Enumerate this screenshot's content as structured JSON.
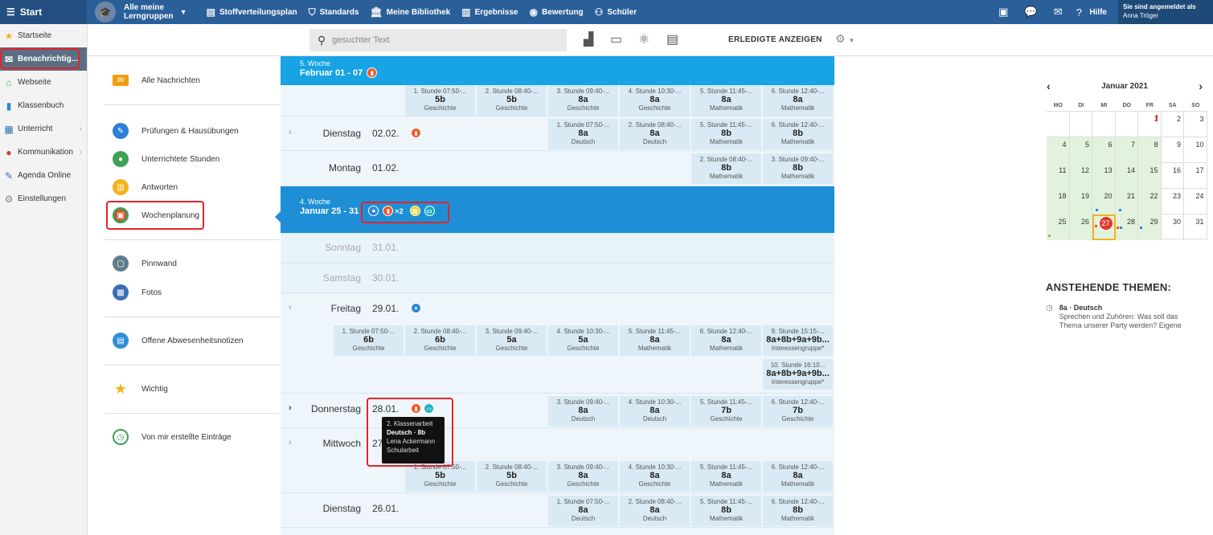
{
  "topbar": {
    "start": "Start",
    "group_line1": "Alle meine",
    "group_line2": "Lerngruppen",
    "items": [
      "Stoffverteilungsplan",
      "Standards",
      "Meine Bibliothek",
      "Ergebnisse",
      "Bewertung",
      "Schüler"
    ],
    "hilfe": "Hilfe",
    "user_label": "Sie sind angemeldet als",
    "user_name": "Anna Tröger"
  },
  "sidebar": {
    "items": [
      {
        "label": "Startseite",
        "icon": "star-icon",
        "color": "#f2b31c"
      },
      {
        "label": "Benachrichtig...",
        "icon": "mail-icon",
        "color": "#ffffff"
      },
      {
        "label": "Webseite",
        "icon": "home-icon",
        "color": "#3ea055"
      },
      {
        "label": "Klassenbuch",
        "icon": "book-icon",
        "color": "#2a86d6"
      },
      {
        "label": "Unterricht",
        "icon": "school-icon",
        "color": "#2a6fb5"
      },
      {
        "label": "Kommunikation",
        "icon": "chat-icon",
        "color": "#d63a2c"
      },
      {
        "label": "Agenda Online",
        "icon": "pen-icon",
        "color": "#3a6fb5"
      },
      {
        "label": "Einstellungen",
        "icon": "gear-icon",
        "color": "#888888"
      }
    ]
  },
  "toolbar": {
    "search_placeholder": "gesuchter Text",
    "erledigte": "ERLEDIGTE ANZEIGEN"
  },
  "nav2": {
    "items": [
      {
        "label": "Alle Nachrichten",
        "color": "#f39c12"
      },
      {
        "label": "Prüfungen & Hausübungen",
        "color": "#2f7ed8"
      },
      {
        "label": "Unterrichtete Stunden",
        "color": "#3ea055"
      },
      {
        "label": "Antworten",
        "color": "#f2b31c"
      },
      {
        "label": "Wochenplanung",
        "color": "#e04b2a"
      },
      {
        "label": "Pinnwand",
        "color": "#607d8b"
      },
      {
        "label": "Fotos",
        "color": "#3a6fb5"
      },
      {
        "label": "Offene Abwesenheitsnotizen",
        "color": "#2f8fd8"
      },
      {
        "label": "Wichtig",
        "color": "#f2b31c"
      },
      {
        "label": "Von mir erstellte Einträge",
        "color": "#3ea055"
      }
    ]
  },
  "weeks": {
    "w5": {
      "num": "5. Woche",
      "range": "Februar 01 - 07"
    },
    "w4": {
      "num": "4. Woche",
      "range": "Januar 25 - 31",
      "count": "×2"
    }
  },
  "rows": {
    "top": {
      "cells": [
        {
          "t": "1. Stunde 07:50-...",
          "c": "5b",
          "s": "Geschichte"
        },
        {
          "t": "2. Stunde 08:40-...",
          "c": "5b",
          "s": "Geschichte"
        },
        {
          "t": "3. Stunde 09:40-...",
          "c": "8a",
          "s": "Geschichte"
        },
        {
          "t": "4. Stunde 10:30-...",
          "c": "8a",
          "s": "Geschichte"
        },
        {
          "t": "5. Stunde 11:45-...",
          "c": "8a",
          "s": "Mathematik"
        },
        {
          "t": "6. Stunde 12:40-...",
          "c": "8a",
          "s": "Mathematik"
        }
      ]
    },
    "di0202": {
      "name": "Dienstag",
      "date": "02.02.",
      "cells": [
        {
          "t": "1. Stunde 07:50-...",
          "c": "8a",
          "s": "Deutsch"
        },
        {
          "t": "2. Stunde 08:40-...",
          "c": "8a",
          "s": "Deutsch"
        },
        {
          "t": "5. Stunde 11:45-...",
          "c": "8b",
          "s": "Mathematik"
        },
        {
          "t": "6. Stunde 12:40-...",
          "c": "8b",
          "s": "Mathematik"
        }
      ]
    },
    "mo0102": {
      "name": "Montag",
      "date": "01.02.",
      "cells": [
        {
          "t": "2. Stunde 08:40-...",
          "c": "8b",
          "s": "Mathematik"
        },
        {
          "t": "3. Stunde 09:40-...",
          "c": "8b",
          "s": "Mathematik"
        }
      ]
    },
    "so3101": {
      "name": "Sonntag",
      "date": "31.01."
    },
    "sa3001": {
      "name": "Samstag",
      "date": "30.01."
    },
    "fr2901": {
      "name": "Freitag",
      "date": "29.01.",
      "cells": [
        {
          "t": "1. Stunde 07:50-...",
          "c": "6b",
          "s": "Geschichte"
        },
        {
          "t": "2. Stunde 08:40-...",
          "c": "6b",
          "s": "Geschichte"
        },
        {
          "t": "3. Stunde 09:40-...",
          "c": "5a",
          "s": "Geschichte"
        },
        {
          "t": "4. Stunde 10:30-...",
          "c": "5a",
          "s": "Geschichte"
        },
        {
          "t": "5. Stunde 11:45-...",
          "c": "8a",
          "s": "Mathematik"
        },
        {
          "t": "6. Stunde 12:40-...",
          "c": "8a",
          "s": "Mathematik"
        },
        {
          "t": "9. Stunde 15:15-...",
          "c": "8a+8b+9a+9b...",
          "s": "Interessengruppe*"
        },
        {
          "t": "10. Stunde 16:10...",
          "c": "8a+8b+9a+9b...",
          "s": "Interessengruppe*"
        }
      ]
    },
    "do2801": {
      "name": "Donnerstag",
      "date": "28.01.",
      "cells": [
        {
          "t": "3. Stunde 09:40-...",
          "c": "8a",
          "s": "Deutsch"
        },
        {
          "t": "4. Stunde 10:30-...",
          "c": "8a",
          "s": "Deutsch"
        },
        {
          "t": "5. Stunde 11:45-...",
          "c": "7b",
          "s": "Geschichte"
        },
        {
          "t": "6. Stunde 12:40-...",
          "c": "7b",
          "s": "Geschichte"
        }
      ]
    },
    "mi2701": {
      "name": "Mittwoch",
      "date": "27",
      "cells": [
        {
          "t": "1. Stunde 07:50-...",
          "c": "5b",
          "s": "Geschichte"
        },
        {
          "t": "2. Stunde 08:40-...",
          "c": "5b",
          "s": "Geschichte"
        },
        {
          "t": "3. Stunde 09:40-...",
          "c": "8a",
          "s": "Geschichte"
        },
        {
          "t": "4. Stunde 10:30-...",
          "c": "8a",
          "s": "Geschichte"
        },
        {
          "t": "5. Stunde 11:45-...",
          "c": "8a",
          "s": "Mathematik"
        },
        {
          "t": "6. Stunde 12:40-...",
          "c": "8a",
          "s": "Mathematik"
        }
      ]
    },
    "di2601": {
      "name": "Dienstag",
      "date": "26.01.",
      "cells": [
        {
          "t": "1. Stunde 07:50-...",
          "c": "8a",
          "s": "Deutsch"
        },
        {
          "t": "2. Stunde 08:40-...",
          "c": "8a",
          "s": "Deutsch"
        },
        {
          "t": "5. Stunde 11:45-...",
          "c": "8b",
          "s": "Mathematik"
        },
        {
          "t": "6. Stunde 12:40-...",
          "c": "8b",
          "s": "Mathematik"
        }
      ]
    }
  },
  "tooltip": {
    "line1": "2. Klassenarbeit",
    "line2": "Deutsch · 8b",
    "line3": "Lena Ackermann",
    "line4": "Schularbeit"
  },
  "calendar": {
    "title": "Januar 2021",
    "prev": "‹",
    "next": "›",
    "dow": [
      "MO",
      "DI",
      "MI",
      "DO",
      "FR",
      "SA",
      "SO"
    ],
    "weeks": [
      [
        "",
        "",
        "",
        "",
        "1",
        "2",
        "3"
      ],
      [
        "4",
        "5",
        "6",
        "7",
        "8",
        "9",
        "10"
      ],
      [
        "11",
        "12",
        "13",
        "14",
        "15",
        "16",
        "17"
      ],
      [
        "18",
        "19",
        "20",
        "21",
        "22",
        "23",
        "24"
      ],
      [
        "25",
        "26",
        "27",
        "28",
        "29",
        "30",
        "31"
      ]
    ]
  },
  "themen": {
    "title": "ANSTEHENDE THEMEN:",
    "item_title": "8a · Deutsch",
    "item_text": "Sprechen und Zuhören: Was soll das Thema unserer Party werden? Eigene"
  },
  "colors": {
    "topbar": "#2a5f99",
    "week_dark": "#1e8fd6",
    "week_light": "#17a3e4",
    "highlight": "#e0252a",
    "exam": "#f05a28",
    "lock": "#2a86d6",
    "note": "#f2d21c",
    "chat": "#1fb0c4"
  }
}
